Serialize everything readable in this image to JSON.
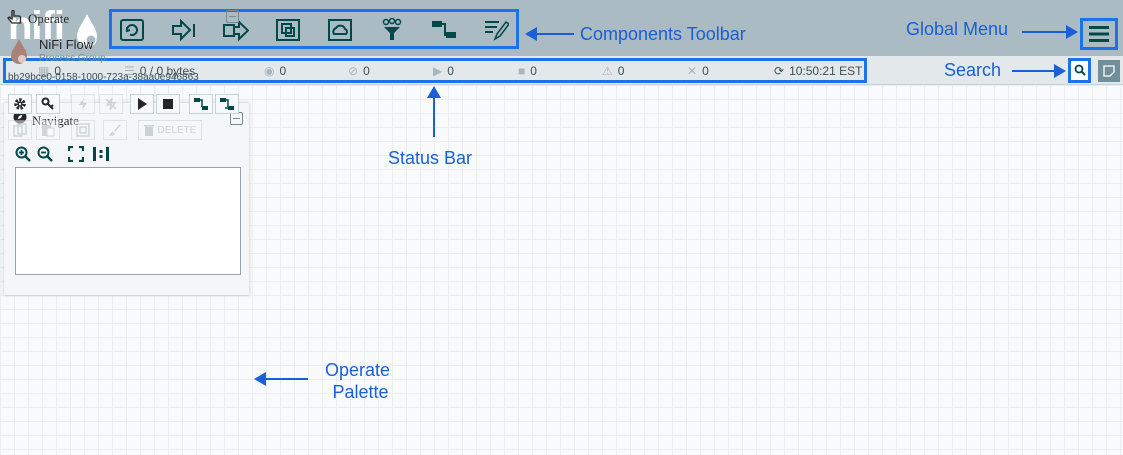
{
  "header": {
    "logo_text": "nifi",
    "toolbar_items": [
      "processor",
      "input-port",
      "output-port",
      "process-group",
      "remote-process-group",
      "funnel",
      "template",
      "label"
    ]
  },
  "status": {
    "threads": "0",
    "queued": "0 / 0 bytes",
    "transmitting": "0",
    "not_transmitting": "0",
    "running": "0",
    "stopped": "0",
    "invalid": "0",
    "disabled": "0",
    "refresh_time": "10:50:21 EST"
  },
  "navigate": {
    "title": "Navigate"
  },
  "operate": {
    "title": "Operate",
    "group_name": "NiFi Flow",
    "group_type": "Process Group",
    "group_id": "bb29bce0-0158-1000-723a-38aa0e946863",
    "delete_label": "DELETE"
  },
  "annotations": {
    "components_toolbar": "Components Toolbar",
    "global_menu": "Global Menu",
    "search": "Search",
    "status_bar": "Status Bar",
    "operate_palette_line1": "Operate",
    "operate_palette_line2": "Palette"
  },
  "colors": {
    "header": "#aabbc3",
    "annotation": "#1a5fd6",
    "highlight": "#1a73e8",
    "icon_dark": "#004849"
  }
}
